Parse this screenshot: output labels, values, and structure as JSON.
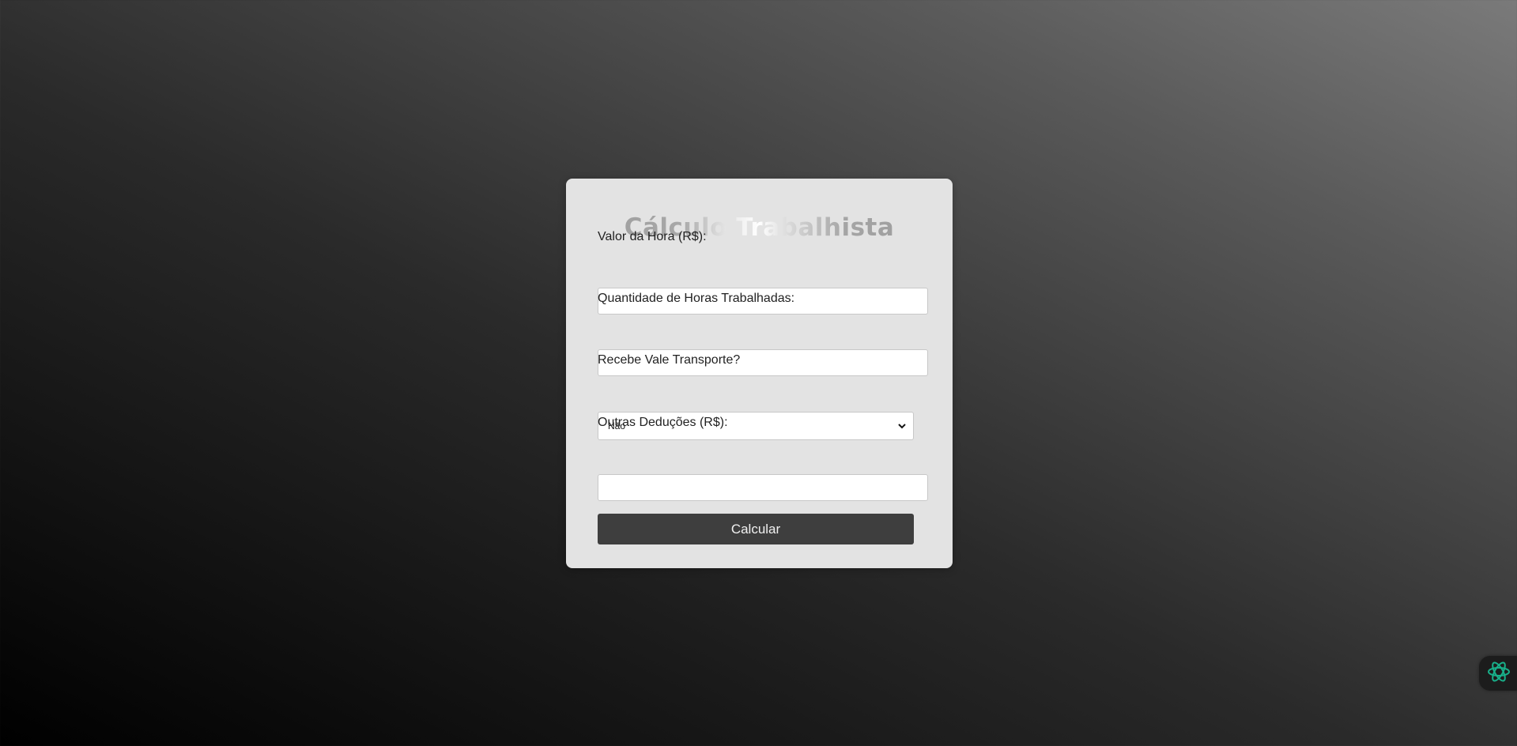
{
  "form": {
    "title": "Cálculo Trabalhista",
    "hourly_rate_label": "Valor da Hora (R$):",
    "hourly_rate_value": "",
    "hours_worked_label": "Quantidade de Horas Trabalhadas:",
    "hours_worked_value": "",
    "transport_label": "Recebe Vale Transporte?",
    "transport_selected": "Não",
    "other_deductions_label": "Outras Deduções (R$):",
    "other_deductions_value": "",
    "submit_label": "Calcular"
  },
  "colors": {
    "card_background": "#e3e3e3",
    "button_background": "#3e3e3e",
    "assistant_icon": "#18b08a"
  },
  "icons": {
    "select_chevron": "chevron-down-icon",
    "assistant": "assistant-icon"
  }
}
